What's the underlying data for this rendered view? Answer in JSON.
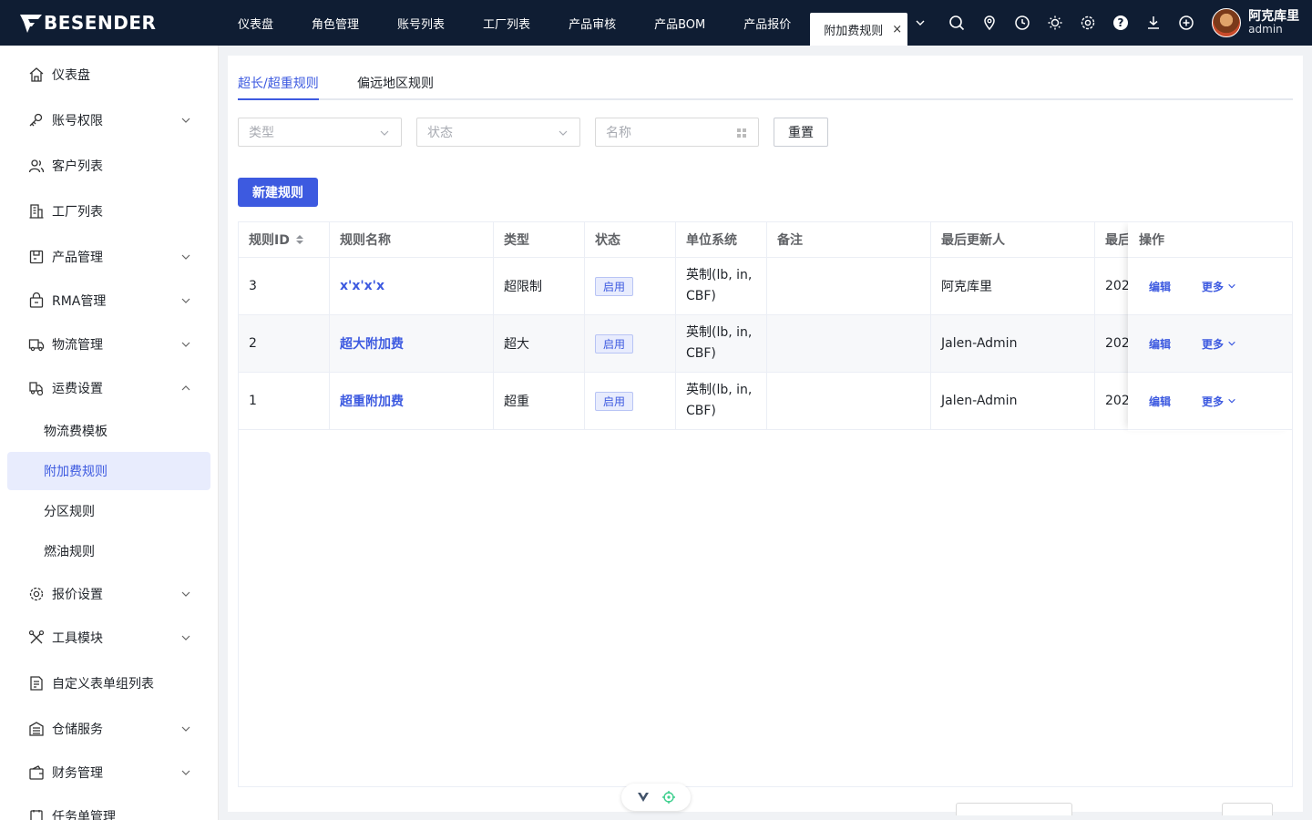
{
  "brand": {
    "name": "BESENDER"
  },
  "nav": {
    "tabs": [
      {
        "label": "仪表盘"
      },
      {
        "label": "角色管理"
      },
      {
        "label": "账号列表"
      },
      {
        "label": "工厂列表"
      },
      {
        "label": "产品审核"
      },
      {
        "label": "产品BOM"
      },
      {
        "label": "产品报价"
      }
    ],
    "active_tab": "附加费规则",
    "close_glyph": "×",
    "tool_icons": [
      "search-icon",
      "location-icon",
      "clock-icon",
      "sun-icon",
      "gear-icon",
      "help-icon",
      "download-icon",
      "plus-circle-icon"
    ]
  },
  "user": {
    "name": "阿克库里",
    "role": "admin"
  },
  "sidebar": {
    "items": [
      {
        "label": "仪表盘",
        "icon": "home-icon"
      },
      {
        "label": "账号权限",
        "icon": "key-icon"
      },
      {
        "label": "客户列表",
        "icon": "users-icon"
      },
      {
        "label": "工厂列表",
        "icon": "building-icon"
      },
      {
        "label": "产品管理",
        "icon": "box-icon"
      },
      {
        "label": "RMA管理",
        "icon": "rma-icon"
      },
      {
        "label": "物流管理",
        "icon": "truck-icon"
      },
      {
        "label": "运费设置",
        "icon": "freight-icon"
      },
      {
        "label": "报价设置",
        "icon": "gear-icon"
      },
      {
        "label": "工具模块",
        "icon": "tools-icon"
      },
      {
        "label": "自定义表单组列表",
        "icon": "form-icon"
      },
      {
        "label": "仓储服务",
        "icon": "warehouse-icon"
      },
      {
        "label": "财务管理",
        "icon": "wallet-icon"
      },
      {
        "label": "任务单管理",
        "icon": "task-icon"
      }
    ],
    "sub_items": [
      {
        "label": "物流费模板"
      },
      {
        "label": "附加费规则"
      },
      {
        "label": "分区规则"
      },
      {
        "label": "燃油规则"
      }
    ]
  },
  "content": {
    "tabs": [
      {
        "label": "超长/超重规则"
      },
      {
        "label": "偏远地区规则"
      }
    ],
    "filters": {
      "type_placeholder": "类型",
      "status_placeholder": "状态",
      "name_placeholder": "名称",
      "reset_label": "重置"
    },
    "new_button": "新建规则",
    "table": {
      "columns": [
        "规则ID",
        "规则名称",
        "类型",
        "状态",
        "单位系统",
        "备注",
        "最后更新人",
        "最后",
        "操作"
      ],
      "rows": [
        {
          "id": "3",
          "name": "x'x'x'x",
          "type": "超限制",
          "status": "启用",
          "unit": "英制(lb, in, CBF)",
          "note": "",
          "updater": "阿克库里",
          "updated": "202"
        },
        {
          "id": "2",
          "name": "超大附加费",
          "type": "超大",
          "status": "启用",
          "unit": "英制(lb, in, CBF)",
          "note": "",
          "updater": "Jalen-Admin",
          "updated": "202"
        },
        {
          "id": "1",
          "name": "超重附加费",
          "type": "超重",
          "status": "启用",
          "unit": "英制(lb, in, CBF)",
          "note": "",
          "updater": "Jalen-Admin",
          "updated": "202"
        }
      ],
      "actions": {
        "edit": "编辑",
        "more": "更多"
      }
    }
  },
  "colors": {
    "header_bg": "#0f1d33",
    "accent": "#3d5ae0",
    "active_sub_bg": "#e8ecfd"
  }
}
